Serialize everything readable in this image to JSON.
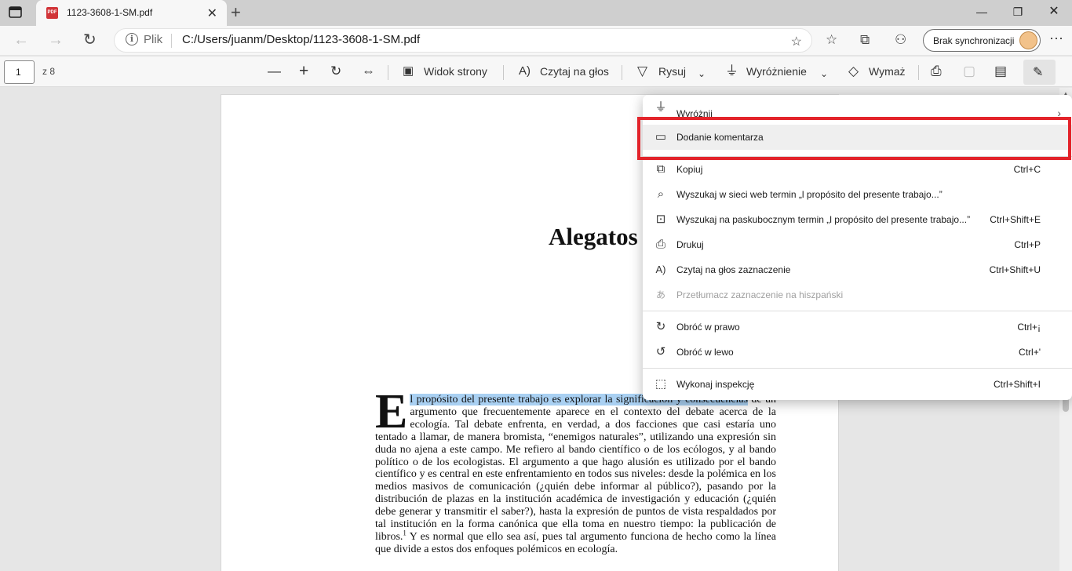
{
  "window": {
    "tab_title": "1123-3608-1-SM.pdf",
    "tab_icon": "pdf-file-icon",
    "new_tab": "+",
    "controls": [
      "minimize",
      "restore",
      "close"
    ]
  },
  "address_bar": {
    "scheme_label": "Plik",
    "url": "C:/Users/juanm/Desktop/1123-3608-1-SM.pdf",
    "sync_label": "Brak synchronizacji"
  },
  "pdf_toolbar": {
    "page_number": "1",
    "page_count": "z 8",
    "page_view": "Widok strony",
    "read_aloud": "Czytaj na głos",
    "draw": "Rysuj",
    "highlight": "Wyróżnienie",
    "erase": "Wymaż"
  },
  "document": {
    "title": "Alegatos",
    "dropcap": "E",
    "highlighted_text": "l propósito del presente trabajo es explorar la significación y consecuencias",
    "body_rest": " de un argumento que frecuentemente aparece en el contexto del debate acerca de la ecología. Tal debate enfrenta, en verdad, a dos facciones que casi estaría uno tentado a llamar, de manera bromista, “enemigos naturales”, utilizando una expresión sin duda no ajena a este campo. Me refiero al bando científico o de los ecólogos, y al bando político o de los ecologistas. El argumento a que hago alusión es utilizado por el bando científico y es central en este enfrentamiento en todos sus niveles: desde la polémica en los medios masivos de comunicación (¿quién debe informar al público?), pasando por la distribución de plazas en la institución académica de investigación y educación (¿quién debe generar y transmitir el saber?), hasta la expresión de puntos de vista respaldados por tal institución en la forma canónica que ella toma en nuestro tiempo: la publicación de libros.",
    "footnote_mark": "1",
    "body_end": " Y es normal que ello sea así, pues tal argumento funciona de hecho como la línea que divide a estos dos enfoques polémicos en ecología."
  },
  "context_menu": {
    "items": [
      {
        "label": "Wyróżnij",
        "shortcut": "",
        "icon": "highlighter-icon"
      },
      {
        "label": "Dodanie komentarza",
        "shortcut": "",
        "icon": "comment-icon"
      },
      {
        "label": "Kopiuj",
        "shortcut": "Ctrl+C",
        "icon": "copy-icon"
      },
      {
        "label": "Wyszukaj w sieci web termin „l propósito del presente trabajo...”",
        "shortcut": "",
        "icon": "search-icon"
      },
      {
        "label": "Wyszukaj na paskubocznym termin „l propósito del presente trabajo...”",
        "shortcut": "Ctrl+Shift+E",
        "icon": "sidebar-search-icon"
      },
      {
        "label": "Drukuj",
        "shortcut": "Ctrl+P",
        "icon": "print-icon"
      },
      {
        "label": "Czytaj na głos zaznaczenie",
        "shortcut": "Ctrl+Shift+U",
        "icon": "read-aloud-icon"
      },
      {
        "label": "Przetłumacz zaznaczenie na hiszpański",
        "shortcut": "",
        "icon": "translate-icon"
      },
      {
        "label": "Obróć w prawo",
        "shortcut": "Ctrl+¡",
        "icon": "rotate-right-icon"
      },
      {
        "label": "Obróć w lewo",
        "shortcut": "Ctrl+'",
        "icon": "rotate-left-icon"
      },
      {
        "label": "Wykonaj inspekcję",
        "shortcut": "Ctrl+Shift+I",
        "icon": "inspect-icon"
      }
    ]
  },
  "colors": {
    "annotation_box": "#e3242b",
    "selection": "#a9d0f2"
  }
}
